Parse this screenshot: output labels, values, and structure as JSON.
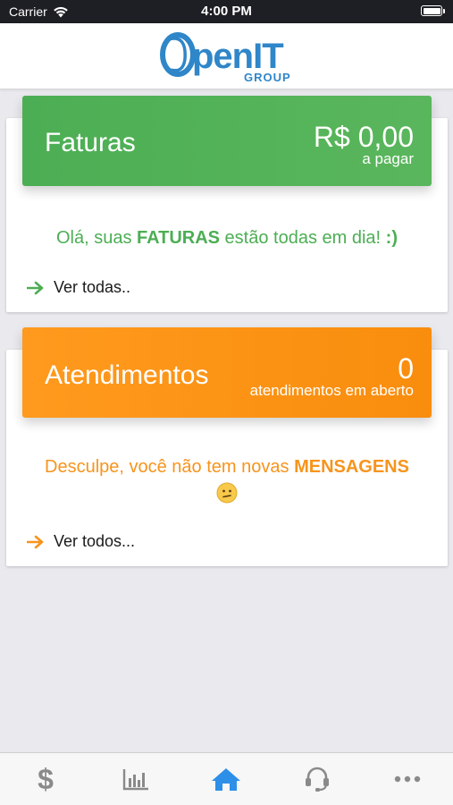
{
  "status_bar": {
    "carrier": "Carrier",
    "time": "4:00 PM"
  },
  "header": {
    "logo_text_main": "penIT",
    "logo_text_sub": "GROUP",
    "logo_color": "#2f86c8"
  },
  "faturas": {
    "title": "Faturas",
    "amount": "R$ 0,00",
    "amount_sub": "a pagar",
    "message_pre": "Olá, suas ",
    "message_bold": "FATURAS",
    "message_post": " estão todas em dia! ",
    "message_end": ":)",
    "link": "Ver todas..",
    "color": "#4cae54"
  },
  "atendimentos": {
    "title": "Atendimentos",
    "count": "0",
    "count_sub": "atendimentos em aberto",
    "message_pre": "Desculpe, você não tem novas ",
    "message_bold": "MENSAGENS",
    "link": "Ver todos...",
    "color": "#f7941d"
  },
  "tab_bar": {
    "active_color": "#2e8fe8",
    "inactive_color": "#8a8a8a",
    "tabs": [
      {
        "icon": "dollar-icon",
        "active": false
      },
      {
        "icon": "bar-chart-icon",
        "active": false
      },
      {
        "icon": "home-icon",
        "active": true
      },
      {
        "icon": "headset-icon",
        "active": false
      },
      {
        "icon": "more-icon",
        "active": false
      }
    ]
  }
}
